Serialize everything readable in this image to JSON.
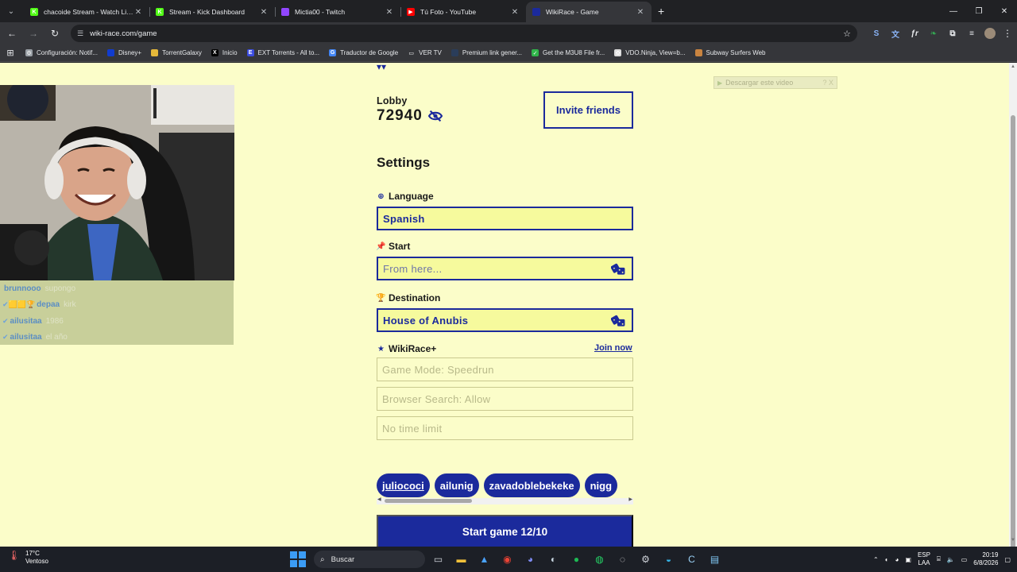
{
  "browser": {
    "tabs": [
      {
        "title": "chacoide Stream - Watch Live o",
        "favicon": "kick-icon",
        "color": "#53fc18",
        "glyph": "K",
        "active": false
      },
      {
        "title": "Stream - Kick Dashboard",
        "favicon": "kick-icon",
        "color": "#53fc18",
        "glyph": "K",
        "active": false
      },
      {
        "title": "Mictia00 - Twitch",
        "favicon": "twitch-icon",
        "color": "#9146ff",
        "glyph": "",
        "active": false
      },
      {
        "title": "Tú Foto - YouTube",
        "favicon": "youtube-icon",
        "color": "#ff0000",
        "glyph": "▶",
        "active": false
      },
      {
        "title": "WikiRace - Game",
        "favicon": "wikirace-icon",
        "color": "#1b2a9c",
        "glyph": "",
        "active": true
      }
    ],
    "url": "wiki-race.com/game",
    "bookmarks": [
      {
        "label": "Configuración: Notif...",
        "icon": "gear-icon",
        "color": "#9aa0a6",
        "glyph": "⚙"
      },
      {
        "label": "Disney+",
        "icon": "disney-icon",
        "color": "#113ccf",
        "glyph": ""
      },
      {
        "label": "TorrentGalaxy",
        "icon": "torrentgalaxy-icon",
        "color": "#e5b83a",
        "glyph": ""
      },
      {
        "label": "Inicio",
        "icon": "x-icon",
        "color": "#000000",
        "glyph": "X"
      },
      {
        "label": "EXT Torrents - All to...",
        "icon": "ext-icon",
        "color": "#3c4de0",
        "glyph": "E"
      },
      {
        "label": "Traductor de Google",
        "icon": "translate-icon",
        "color": "#4285f4",
        "glyph": "G"
      },
      {
        "label": "VER TV",
        "icon": "folder-icon",
        "color": "#35363a",
        "glyph": "▭"
      },
      {
        "label": "Premium link gener...",
        "icon": "link-icon",
        "color": "#2a3d5a",
        "glyph": ""
      },
      {
        "label": "Get the M3U8 File fr...",
        "icon": "m3u8-icon",
        "color": "#30b54a",
        "glyph": "✓"
      },
      {
        "label": "VDO.Ninja, View=b...",
        "icon": "vdo-ninja-icon",
        "color": "#dddddd",
        "glyph": "✿"
      },
      {
        "label": "Subway Surfers Web",
        "icon": "subway-icon",
        "color": "#c98440",
        "glyph": ""
      }
    ]
  },
  "page": {
    "lobby_label": "Lobby",
    "lobby_code": "72940",
    "invite_label": "Invite friends",
    "settings_title": "Settings",
    "language": {
      "label": "Language",
      "value": "Spanish"
    },
    "start": {
      "label": "Start",
      "placeholder": "From here..."
    },
    "destination": {
      "label": "Destination",
      "value": "House of Anubis"
    },
    "wikirace_plus": {
      "label": "WikiRace+",
      "join": "Join now"
    },
    "game_mode": "Game Mode: Speedrun",
    "browser_search": "Browser Search: Allow",
    "time_limit": "No time limit",
    "players": [
      "juliococi",
      "ailunig",
      "zavadoblebekeke",
      "nigg"
    ],
    "start_button": "Start game 12/10",
    "download_overlay": "Descargar este video",
    "download_overlay_extra": "? X"
  },
  "chat": [
    {
      "user": "brunnooo",
      "message": "supongo",
      "badges": ""
    },
    {
      "user": "depaa",
      "message": "kirk",
      "badges": "✔🟨🟨🏆"
    },
    {
      "user": "ailusitaa",
      "message": "1986",
      "badges": "✔"
    },
    {
      "user": "ailusitaa",
      "message": "el año",
      "badges": "✔"
    }
  ],
  "taskbar": {
    "weather_temp": "17°C",
    "weather_desc": "Ventoso",
    "search_label": "Buscar",
    "lang_line1": "ESP",
    "lang_line2": "LAA",
    "time": "20:19",
    "date": "6/8/2026"
  },
  "colors": {
    "page_bg": "#fbfdc9",
    "accent": "#1b2a9c",
    "field_bg": "#f6fa9d"
  }
}
